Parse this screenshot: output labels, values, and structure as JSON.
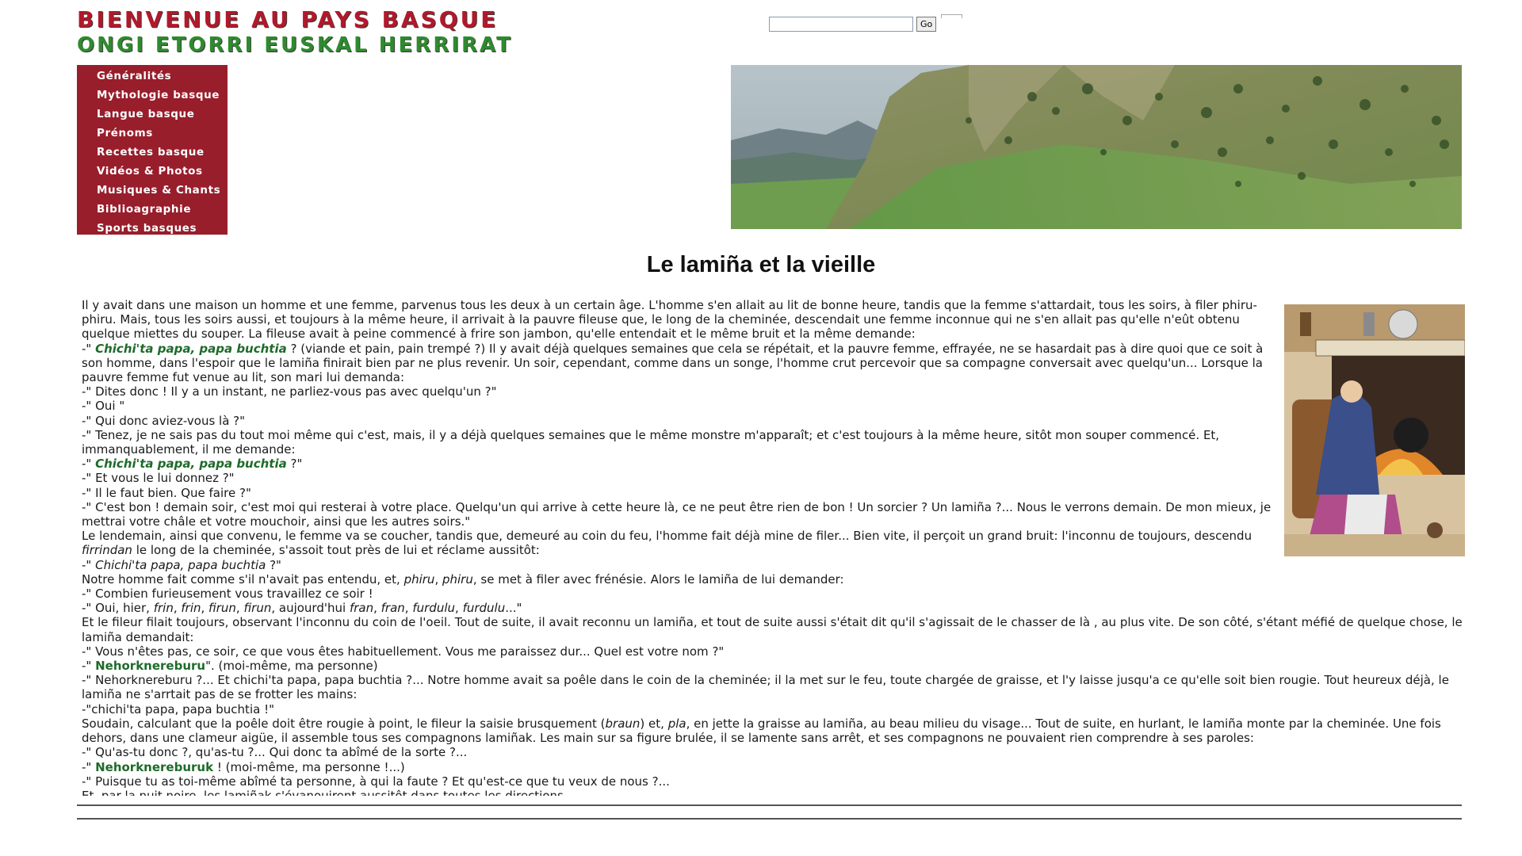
{
  "header": {
    "logo_line1": "BIENVENUE AU PAYS BASQUE",
    "logo_line2": "ONGI ETORRI EUSKAL HERRIRAT"
  },
  "search": {
    "value": "",
    "placeholder": "",
    "button_label": "Go"
  },
  "sidebar": {
    "items": [
      {
        "label": "Généralités"
      },
      {
        "label": "Mythologie basque"
      },
      {
        "label": "Langue basque"
      },
      {
        "label": "Prénoms"
      },
      {
        "label": "Recettes basque"
      },
      {
        "label": "Vidéos & Photos"
      },
      {
        "label": "Musiques & Chants"
      },
      {
        "label": "Biblioagraphie"
      },
      {
        "label": "Sports basques"
      }
    ]
  },
  "colors": {
    "sidebar_bg": "#981e2c",
    "highlight_green": "#1e6b2a",
    "logo_red": "#b3182a",
    "logo_green": "#2e8b2e"
  },
  "article": {
    "title": "Le lamiña et la vieille",
    "p1": "Il y avait dans une maison un homme et une femme, parvenus tous les deux à un certain âge. L'homme s'en allait au lit de bonne heure, tandis que la femme s'attardait, tous les soirs, à filer phiru-phiru. Mais, tous les soirs aussi, et toujours à la même heure, il arrivait à la pauvre fileuse que, le long de la cheminée, descendait une femme inconnue qui ne s'en allait pas qu'elle n'eût obtenu quelque miettes du souper. La fileuse avait à peine commencé à frire son jambon, qu'elle entendait et le même bruit et la même demande:",
    "l2_pre": "-\" ",
    "l2_hl": "Chichi'ta papa, papa buchtia",
    "l2_post": " ? (viande et pain, pain trempé ?) Il y avait déjà quelques semaines que cela se répétait, et la pauvre femme, effrayée, ne se hasardait pas à dire quoi que ce soit à son homme, dans l'espoir que le lamiña finirait bien par ne plus revenir. Un soir, cependant, comme dans un songe, l'homme crut percevoir que sa compagne conversait avec quelqu'un... Lorsque la pauvre femme fut venue au lit, son mari lui demanda:",
    "l3": "-\" Dites donc ! Il y a un instant, ne parliez-vous pas avec quelqu'un ?\"",
    "l4": "-\" Oui \"",
    "l5": "-\" Qui donc aviez-vous là ?\"",
    "l6": "-\" Tenez, je ne sais pas du tout moi même qui c'est, mais, il y a déjà quelques semaines que le même monstre m'apparaît; et c'est toujours à la même heure, sitôt mon souper commencé. Et, immanquablement, il me demande:",
    "l7_pre": "-\" ",
    "l7_hl": "Chichi'ta papa, papa buchtia",
    "l7_post": " ?\"",
    "l8": "-\" Et vous le lui donnez ?\"",
    "l9": "-\" Il le faut bien. Que faire ?\"",
    "l10": "-\" C'est bon ! demain soir, c'est moi qui resterai à votre place. Quelqu'un qui arrive à cette heure là, ce ne peut être rien de bon ! Un sorcier ? Un lamiña ?... Nous le verrons demain. De mon mieux, je mettrai votre châle et votre mouchoir, ainsi que les autres soirs.\"",
    "l11_a": "Le lendemain, ainsi que convenu, le femme va se coucher, tandis que, demeuré au coin du feu, l'homme fait déjà mine de filer... Bien vite, il perçoit un grand bruit: l'inconnu de toujours, descendu ",
    "l11_i": "firrindan",
    "l11_b": " le long de la cheminée, s'assoit tout près de lui et réclame aussitôt:",
    "l12_pre": "-\" ",
    "l12_i": "Chichi'ta papa, papa buchtia",
    "l12_post": " ?\"",
    "l13_a": "Notre homme fait comme s'il n'avait pas entendu, et, ",
    "l13_i1": "phiru",
    "l13_b": ", ",
    "l13_i2": "phiru",
    "l13_c": ", se met à filer avec frénésie. Alors le lamiña de lui demander:",
    "l14": "-\" Combien furieusement vous travaillez ce soir !",
    "l15_a": "-\" Oui, hier, ",
    "l15_i1": "frin",
    "l15_s1": ", ",
    "l15_i2": "frin",
    "l15_s2": ", ",
    "l15_i3": "firun",
    "l15_s3": ", ",
    "l15_i4": "firun",
    "l15_s4": ", aujourd'hui ",
    "l15_i5": "fran",
    "l15_s5": ", ",
    "l15_i6": "fran",
    "l15_s6": ", ",
    "l15_i7": "furdulu",
    "l15_s7": ", ",
    "l15_i8": "furdulu",
    "l15_end": "...\"",
    "l16": "Et le fileur filait toujours, observant l'inconnu du coin de l'oeil. Tout de suite, il avait reconnu un lamiña, et tout de suite aussi s'était dit qu'il s'agissait de le chasser de là , au plus vite. De son côté, s'étant méfié de quelque chose, le lamiña demandait:",
    "l17": "-\" Vous n'êtes pas, ce soir, ce que vous êtes habituellement. Vous me paraissez dur... Quel est votre nom ?\"",
    "l18_pre": "-\" ",
    "l18_hl": "Nehorknereburu",
    "l18_post": "\". (moi-même, ma personne)",
    "l19": "-\" Nehorknereburu ?... Et chichi'ta papa, papa buchtia ?... Notre homme avait sa poêle dans le coin de la cheminée; il la met sur le feu, toute chargée de graisse, et l'y laisse jusqu'a ce qu'elle soit bien rougie. Tout heureux déjà, le lamiña ne s'arrtait pas de se frotter les mains:",
    "l20": "-\"chichi'ta papa, papa buchtia !\"",
    "l21_a": "Soudain, calculant que la poêle doit être rougie à point, le fileur la saisie brusquement (",
    "l21_i1": "braun",
    "l21_b": ") et, ",
    "l21_i2": "pla",
    "l21_c": ", en jette la graisse au lamiña, au beau milieu du visage... Tout de suite, en hurlant, le lamiña monte par la cheminée. Une fois dehors, dans une clameur aigüe, il assemble tous ses compagnons lamiñak. Les main sur sa figure brulée, il se lamente sans arrêt, et ses compagnons ne pouvaient rien comprendre à ses paroles:",
    "l22": "-\" Qu'as-tu donc ?, qu'as-tu ?... Qui donc ta abîmé de la sorte ?...",
    "l23_pre": "-\" ",
    "l23_hl": "Nehorknereburuk",
    "l23_post": " ! (moi-même, ma personne !...)",
    "l24": "-\" Puisque tu as toi-même abîmé ta personne, à qui la faute ? Et qu'est-ce que tu veux de nous ?...",
    "l25": "Et, par la nuit noire, les lamiñak s'évanouirent aussitôt dans toutes les directions."
  }
}
